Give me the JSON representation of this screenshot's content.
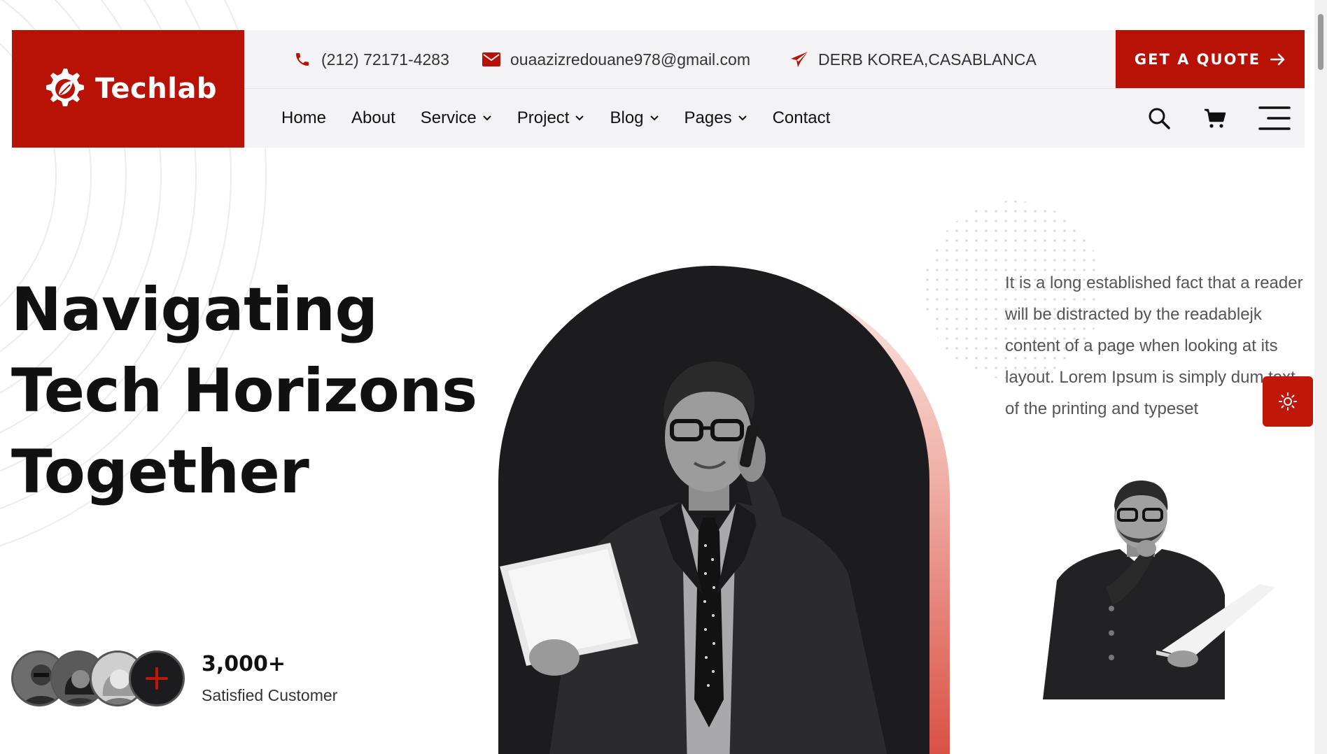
{
  "brand": {
    "name": "Techlab",
    "logo_icon": "gear-leaf-icon",
    "accent_color": "#b81206"
  },
  "topbar": {
    "phone": {
      "icon": "phone-icon",
      "text": "(212) 72171-4283"
    },
    "email": {
      "icon": "envelope-icon",
      "text": "ouaazizredouane978@gmail.com"
    },
    "address": {
      "icon": "paper-plane-icon",
      "text": "DERB KOREA,CASABLANCA"
    },
    "quote_button": {
      "label": "GET A QUOTE",
      "icon": "arrow-right-icon"
    }
  },
  "nav": {
    "items": [
      {
        "label": "Home",
        "dropdown": false
      },
      {
        "label": "About",
        "dropdown": false
      },
      {
        "label": "Service",
        "dropdown": true
      },
      {
        "label": "Project",
        "dropdown": true
      },
      {
        "label": "Blog",
        "dropdown": true
      },
      {
        "label": "Pages",
        "dropdown": true
      },
      {
        "label": "Contact",
        "dropdown": false
      }
    ],
    "tools": [
      "search-icon",
      "cart-icon",
      "menu-icon"
    ]
  },
  "hero": {
    "title_lines": [
      "Navigating",
      "Tech Horizons",
      "Together"
    ],
    "customers_count": "3,000+",
    "customers_label": "Satisfied Customer",
    "description": "It is a long established fact that a reader will be distracted by the readablejk content of a page when looking at its layout. Lorem Ipsum is simply dum text of the printing and typeset"
  },
  "theme_toggle": {
    "icon": "sun-icon"
  }
}
